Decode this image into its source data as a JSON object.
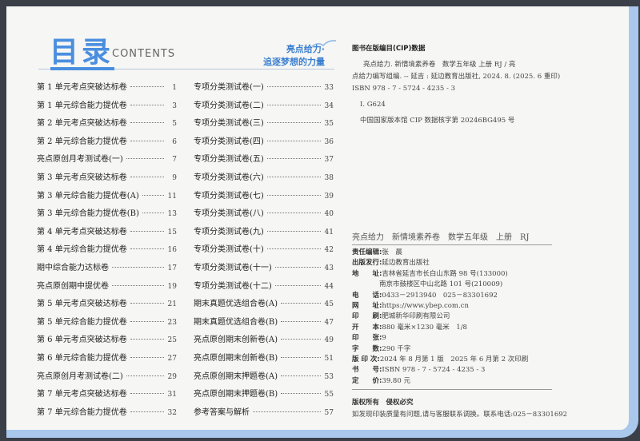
{
  "header": {
    "title": "目录",
    "subtitle": "CONTENTS",
    "slogan_line1": "亮点给力·",
    "slogan_line2": "追逐梦想的力量"
  },
  "toc_left": [
    {
      "name": "第 1 单元考点突破达标卷",
      "page": "1"
    },
    {
      "name": "第 1 单元综合能力提优卷",
      "page": "3"
    },
    {
      "name": "第 2 单元考点突破达标卷",
      "page": "5"
    },
    {
      "name": "第 2 单元综合能力提优卷",
      "page": "6"
    },
    {
      "name": "亮点原创月考测试卷(一)",
      "page": "7"
    },
    {
      "name": "第 3 单元考点突破达标卷",
      "page": "9"
    },
    {
      "name": "第 3 单元综合能力提优卷(A)",
      "page": "11"
    },
    {
      "name": "第 3 单元综合能力提优卷(B)",
      "page": "13"
    },
    {
      "name": "第 4 单元考点突破达标卷",
      "page": "15"
    },
    {
      "name": "第 4 单元综合能力提优卷",
      "page": "16"
    },
    {
      "name": "期中综合能力达标卷",
      "page": "17"
    },
    {
      "name": "亮点原创期中提优卷",
      "page": "19"
    },
    {
      "name": "第 5 单元考点突破达标卷",
      "page": "21"
    },
    {
      "name": "第 5 单元综合能力提优卷",
      "page": "23"
    },
    {
      "name": "第 6 单元考点突破达标卷",
      "page": "25"
    },
    {
      "name": "第 6 单元综合能力提优卷",
      "page": "27"
    },
    {
      "name": "亮点原创月考测试卷(二)",
      "page": "29"
    },
    {
      "name": "第 7 单元考点突破达标卷",
      "page": "31"
    },
    {
      "name": "第 7 单元综合能力提优卷",
      "page": "32"
    }
  ],
  "toc_right": [
    {
      "name": "专项分类测试卷(一)",
      "page": "33"
    },
    {
      "name": "专项分类测试卷(二)",
      "page": "34"
    },
    {
      "name": "专项分类测试卷(三)",
      "page": "35"
    },
    {
      "name": "专项分类测试卷(四)",
      "page": "36"
    },
    {
      "name": "专项分类测试卷(五)",
      "page": "37"
    },
    {
      "name": "专项分类测试卷(六)",
      "page": "38"
    },
    {
      "name": "专项分类测试卷(七)",
      "page": "39"
    },
    {
      "name": "专项分类测试卷(八)",
      "page": "40"
    },
    {
      "name": "专项分类测试卷(九)",
      "page": "41"
    },
    {
      "name": "专项分类测试卷(十)",
      "page": "42"
    },
    {
      "name": "专项分类测试卷(十一)",
      "page": "43"
    },
    {
      "name": "专项分类测试卷(十二)",
      "page": "44"
    },
    {
      "name": "期末真题优选组合卷(A)",
      "page": "45"
    },
    {
      "name": "期末真题优选组合卷(B)",
      "page": "47"
    },
    {
      "name": "亮点原创期末创新卷(A)",
      "page": "49"
    },
    {
      "name": "亮点原创期末创新卷(B)",
      "page": "51"
    },
    {
      "name": "亮点原创期末押题卷(A)",
      "page": "53"
    },
    {
      "name": "亮点原创期末押题卷(B)",
      "page": "55"
    },
    {
      "name": "参考答案与解析",
      "page": "57"
    }
  ],
  "cip": {
    "heading": "图书在版编目(CIP)数据",
    "line1": "亮点给力. 新情境素养卷　数学五年级 上册 RJ / 亮",
    "line2": "点给力编写组编. -- 延吉 : 延边教育出版社, 2024. 8. (2025. 6 重印)",
    "line3": "ISBN 978 - 7 - 5724 - 4235 - 3",
    "line4": "Ⅰ. G624",
    "line5": "中国国家版本馆 CIP 数据核字第 20246BG495 号"
  },
  "imprint": {
    "book_title": "亮点给力　新情境素养卷　数学五年级　上册　RJ",
    "rows": [
      {
        "label": "责任编辑:",
        "value": "张　晨"
      },
      {
        "label": "出版发行:",
        "value": "延边教育出版社"
      },
      {
        "label": "地　　址:",
        "value": "吉林省延吉市长白山东路 98 号(133000)"
      },
      {
        "label": "　　　　",
        "value": "南京市鼓楼区中山北路 101 号(210009)"
      },
      {
        "label": "电　　话:",
        "value": "0433－2913940　025－83301692"
      },
      {
        "label": "网　　址:",
        "value": "https://www.ybep.com.cn"
      },
      {
        "label": "印　　刷:",
        "value": "肥城新华印刷有限公司"
      },
      {
        "label": "开　　本:",
        "value": "880 毫米×1230 毫米　1/8"
      },
      {
        "label": "印　　张:",
        "value": "9"
      },
      {
        "label": "字　　数:",
        "value": "290 千字"
      },
      {
        "label": "版 印 次:",
        "value": "2024 年 8 月第 1 版　2025 年 6 月第 2 次印刷"
      },
      {
        "label": "书　　号:",
        "value": "ISBN 978 - 7 - 5724 - 4235 - 3"
      },
      {
        "label": "定　　价:",
        "value": "39.80 元"
      }
    ]
  },
  "rights": {
    "heading": "版权所有　侵权必究",
    "note": "如发现印装质量有问题,请与客服联系调换。联系电话:025－83301692"
  }
}
